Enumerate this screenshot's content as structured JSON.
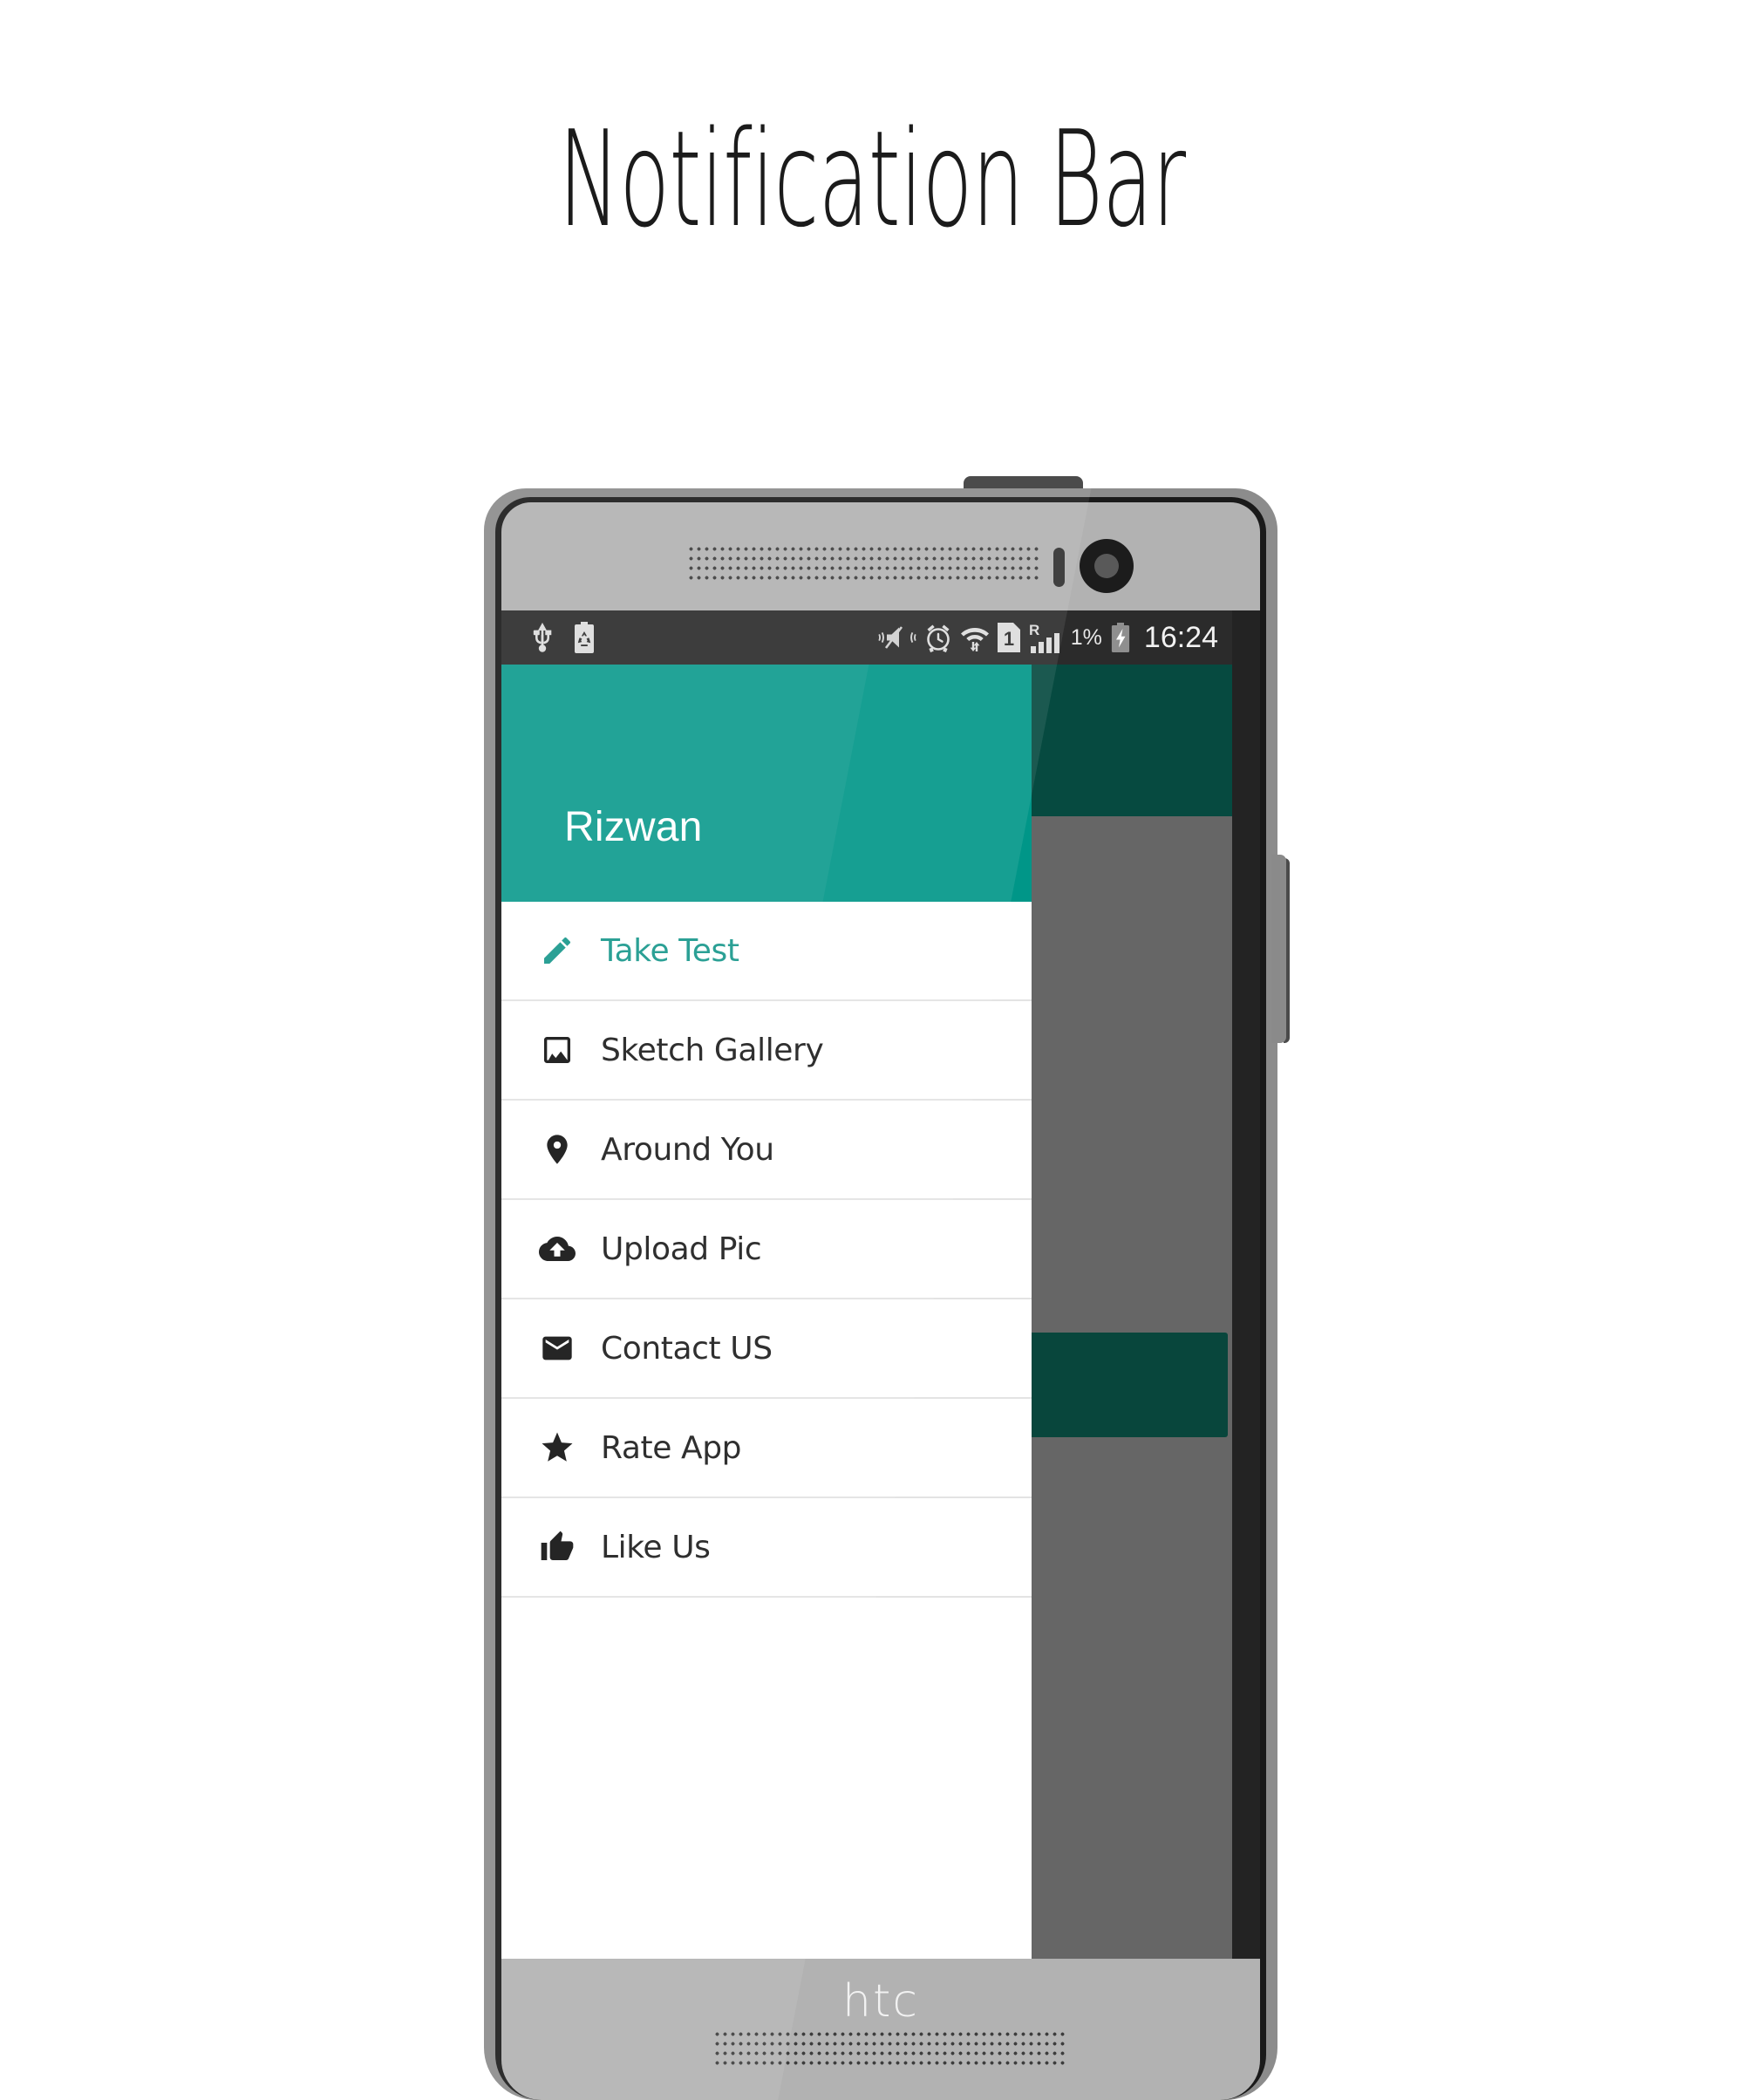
{
  "page": {
    "title": "Notification Bar",
    "device_brand": "htc",
    "accent_color": "#009688",
    "accent_selected_text": "#17988c",
    "scrim_toolbar_color": "#064a40",
    "scrim_body_color": "#666666",
    "status_bar_color": "#2b2b2b"
  },
  "status_bar": {
    "left_icons": [
      {
        "name": "usb-icon",
        "label": "USB connected"
      },
      {
        "name": "battery-saver-icon",
        "label": "Power saving mode"
      }
    ],
    "right_icons": [
      {
        "name": "vibrate-mute-icon",
        "label": "Ringer silent / vibrate"
      },
      {
        "name": "alarm-clock-icon",
        "label": "Alarm set"
      },
      {
        "name": "wifi-icon",
        "label": "Wi-Fi connected"
      },
      {
        "name": "sim-1-icon",
        "label": "SIM 1"
      },
      {
        "name": "roaming-signal-icon",
        "label": "R"
      }
    ],
    "battery_percent": "1%",
    "battery_state": "charging",
    "clock": "16:24"
  },
  "drawer": {
    "username": "Rizwan",
    "items": [
      {
        "label": "Take Test",
        "icon": "pencil-icon",
        "selected": true
      },
      {
        "label": "Sketch Gallery",
        "icon": "image-icon",
        "selected": false
      },
      {
        "label": "Around You",
        "icon": "location-pin-icon",
        "selected": false
      },
      {
        "label": "Upload Pic",
        "icon": "cloud-upload-icon",
        "selected": false
      },
      {
        "label": "Contact US",
        "icon": "envelope-icon",
        "selected": false
      },
      {
        "label": "Rate App",
        "icon": "star-icon",
        "selected": false
      },
      {
        "label": "Like Us",
        "icon": "thumbs-up-icon",
        "selected": false
      }
    ]
  }
}
